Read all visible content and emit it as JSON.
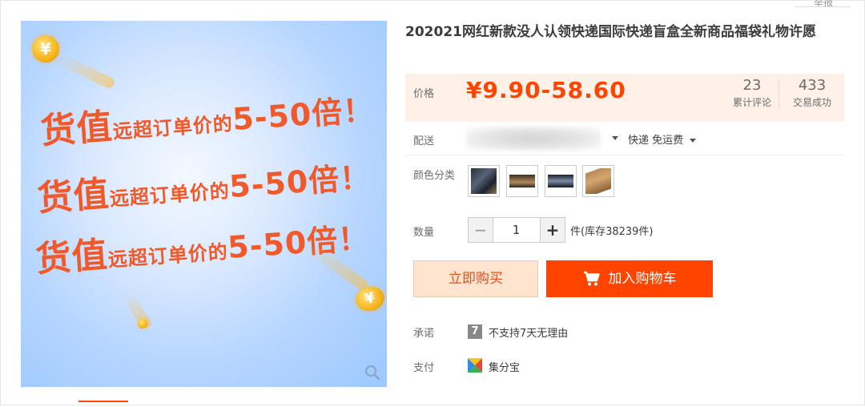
{
  "top": {
    "report": "举报"
  },
  "image": {
    "lines": [
      {
        "big": "货值",
        "small": "远超订单价的",
        "num": "5-50倍！"
      },
      {
        "big": "货值",
        "small": "远超订单价的",
        "num": "5-50倍！"
      },
      {
        "big": "货值",
        "small": "远超订单价的",
        "num": "5-50倍！"
      }
    ],
    "coin_glyph": "¥"
  },
  "product": {
    "title": "202021网红新款没人认领快递国际快递盲盒全新商品福袋礼物许愿"
  },
  "price": {
    "label": "价格",
    "value": "¥9.90-58.60",
    "reviews_count": "23",
    "reviews_label": "累计评论",
    "sales_count": "433",
    "sales_label": "交易成功"
  },
  "shipping": {
    "label": "配送",
    "method": "快递 免运费"
  },
  "color": {
    "label": "颜色分类",
    "swatches": [
      "dark-box-swatch",
      "watches-swatch",
      "phones-swatch",
      "cardboard-box-swatch"
    ]
  },
  "quantity": {
    "label": "数量",
    "minus": "−",
    "value": "1",
    "plus": "+",
    "stock": "件(库存38239件)"
  },
  "actions": {
    "buy_now": "立即购买",
    "add_cart": "加入购物车"
  },
  "promise": {
    "label": "承诺",
    "icon_glyph": "7",
    "text": "不支持7天无理由"
  },
  "payment": {
    "label": "支付",
    "text": "集分宝"
  },
  "colors": {
    "accent": "#ff4400",
    "price_bg": "#fff0e8",
    "buy_now_bg": "#ffe4d0"
  }
}
